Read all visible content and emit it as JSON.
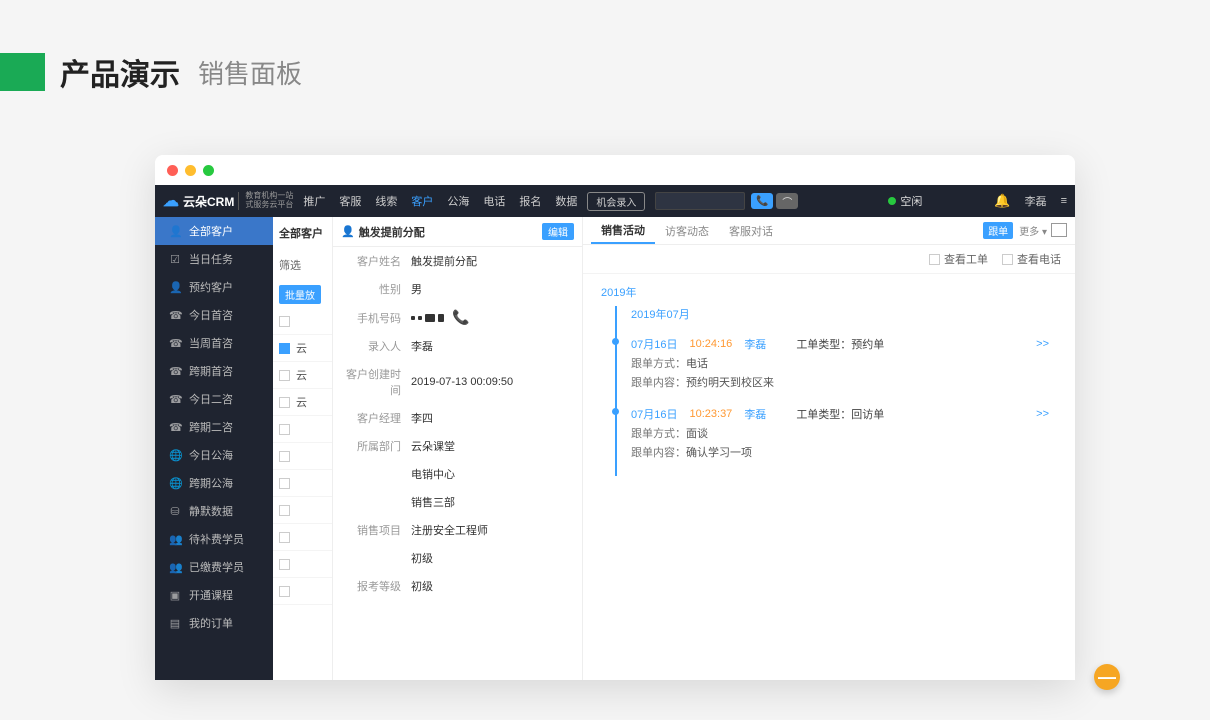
{
  "page": {
    "title": "产品演示",
    "subtitle": "销售面板"
  },
  "topnav": {
    "brand": "云朵CRM",
    "brand_sub1": "教育机构一站",
    "brand_sub2": "式服务云平台",
    "items": [
      "推广",
      "客服",
      "线索",
      "客户",
      "公海",
      "电话",
      "报名",
      "数据"
    ],
    "active_index": 3,
    "opportunity_btn": "机会录入",
    "status": "空闲",
    "user": "李磊"
  },
  "sidebar": {
    "items": [
      {
        "icon": "👤",
        "label": "全部客户"
      },
      {
        "icon": "☑",
        "label": "当日任务"
      },
      {
        "icon": "👤",
        "label": "预约客户"
      },
      {
        "icon": "☎",
        "label": "今日首咨"
      },
      {
        "icon": "☎",
        "label": "当周首咨"
      },
      {
        "icon": "☎",
        "label": "跨期首咨"
      },
      {
        "icon": "☎",
        "label": "今日二咨"
      },
      {
        "icon": "☎",
        "label": "跨期二咨"
      },
      {
        "icon": "🌐",
        "label": "今日公海"
      },
      {
        "icon": "🌐",
        "label": "跨期公海"
      },
      {
        "icon": "⛁",
        "label": "静默数据"
      },
      {
        "icon": "👥",
        "label": "待补费学员"
      },
      {
        "icon": "👥",
        "label": "已缴费学员"
      },
      {
        "icon": "▣",
        "label": "开通课程"
      },
      {
        "icon": "▤",
        "label": "我的订单"
      }
    ],
    "active_index": 0
  },
  "list": {
    "header": "全部客户",
    "filter_label": "筛选",
    "batch_btn": "批量放",
    "rows": [
      {
        "checked": false,
        "text": ""
      },
      {
        "checked": true,
        "text": "云"
      },
      {
        "checked": false,
        "text": "云"
      },
      {
        "checked": false,
        "text": "云"
      },
      {
        "checked": false,
        "text": ""
      },
      {
        "checked": false,
        "text": ""
      },
      {
        "checked": false,
        "text": ""
      },
      {
        "checked": false,
        "text": ""
      },
      {
        "checked": false,
        "text": ""
      },
      {
        "checked": false,
        "text": ""
      },
      {
        "checked": false,
        "text": ""
      }
    ]
  },
  "detail": {
    "header_title": "触发提前分配",
    "edit_btn": "编辑",
    "fields": [
      {
        "label": "客户姓名",
        "value": "触发提前分配"
      },
      {
        "label": "性别",
        "value": "男"
      },
      {
        "label": "手机号码",
        "value": "__masked__",
        "phone": true
      },
      {
        "label": "录入人",
        "value": "李磊"
      },
      {
        "label": "客户创建时间",
        "value": "2019-07-13 00:09:50"
      },
      {
        "label": "客户经理",
        "value": "李四"
      },
      {
        "label": "所属部门",
        "value": "云朵课堂"
      },
      {
        "label": "",
        "value": "电销中心"
      },
      {
        "label": "",
        "value": "销售三部"
      },
      {
        "label": "销售项目",
        "value": "注册安全工程师"
      },
      {
        "label": "",
        "value": "初级"
      },
      {
        "label": "报考等级",
        "value": "初级"
      }
    ]
  },
  "activity": {
    "tabs": [
      "销售活动",
      "访客动态",
      "客服对话"
    ],
    "active_tab": 0,
    "follow_badge": "跟单",
    "more": "更多 ▾",
    "filters": {
      "ticket": "查看工单",
      "call": "查看电话"
    },
    "year": "2019年",
    "month": "2019年07月",
    "entries": [
      {
        "date": "07月16日",
        "time": "10:24:16",
        "user": "李磊",
        "type_label": "工单类型：",
        "type_value": "预约单",
        "method_label": "跟单方式：",
        "method_value": "电话",
        "content_label": "跟单内容：",
        "content_value": "预约明天到校区来",
        "expand": ">>"
      },
      {
        "date": "07月16日",
        "time": "10:23:37",
        "user": "李磊",
        "type_label": "工单类型：",
        "type_value": "回访单",
        "method_label": "跟单方式：",
        "method_value": "面谈",
        "content_label": "跟单内容：",
        "content_value": "确认学习一项",
        "expand": ">>"
      }
    ]
  }
}
